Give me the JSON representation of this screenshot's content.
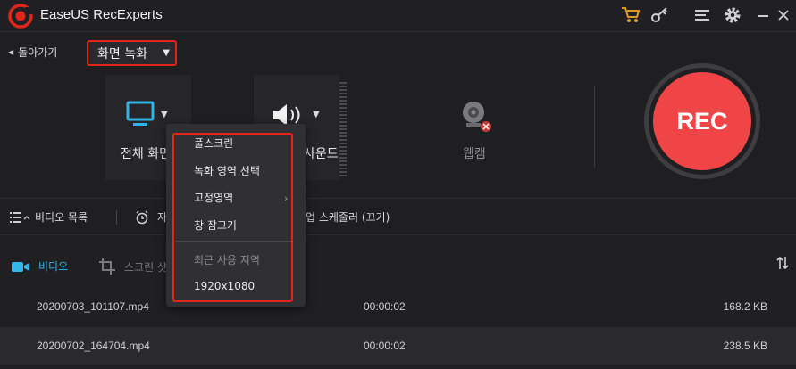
{
  "app": {
    "title": "EaseUS RecExperts"
  },
  "titlebar": {
    "icons": [
      "cart-icon",
      "key-icon",
      "menu-icon",
      "gear-icon",
      "minimize-icon",
      "close-icon"
    ]
  },
  "nav": {
    "back_label": "돌아가기",
    "mode_value": "화면 녹화"
  },
  "sources": {
    "screen_label": "전체 화면",
    "sound_label": "사운드",
    "webcam_label": "웹캠"
  },
  "rec": {
    "label": "REC"
  },
  "toolbar": {
    "video_list": "비디오 목록",
    "task_label": "자",
    "scheduler": "업 스케줄러 (끄기)"
  },
  "files": {
    "tab_video": "비디오",
    "tab_screenshot": "스크린 샷",
    "rows": [
      {
        "name": "20200703_101107.mp4",
        "duration": "00:00:02",
        "size": "168.2 KB"
      },
      {
        "name": "20200702_164704.mp4",
        "duration": "00:00:02",
        "size": "238.5 KB"
      }
    ]
  },
  "menu": {
    "items": [
      "풀스크린",
      "녹화 영역 선택",
      "고정영역",
      "창 잠그기"
    ],
    "recent_header": "최근 사용 지역",
    "recent_items": [
      "1920x1080"
    ]
  },
  "colors": {
    "accent_red": "#e1251b",
    "rec_red": "#f04546",
    "active_blue": "#34b6e8",
    "background": "#1f1f22"
  }
}
